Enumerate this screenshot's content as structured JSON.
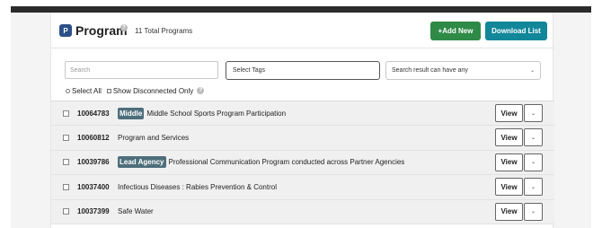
{
  "header": {
    "logo_letter": "P",
    "title": "Program",
    "total_label": "11 Total Programs",
    "add_button": "+Add New",
    "download_button": "Download List"
  },
  "filters": {
    "search_placeholder": "Search",
    "tags_label": "Select Tags",
    "match_select": "Search result can have any",
    "select_all_label": "Select All",
    "show_disconnected_label": "Show Disconnected Only"
  },
  "rows": [
    {
      "id": "10064783",
      "badge": "Middle",
      "title": "Middle School Sports Program Participation",
      "view_label": "View"
    },
    {
      "id": "10060812",
      "badge": "",
      "title": "Program and Services",
      "view_label": "View"
    },
    {
      "id": "10039786",
      "badge": "Lead Agency",
      "title": "Professional Communication Program conducted across Partner Agencies",
      "view_label": "View"
    },
    {
      "id": "10037400",
      "badge": "",
      "title": "Infectious Diseases : Rabies Prevention & Control",
      "view_label": "View"
    },
    {
      "id": "10037399",
      "badge": "",
      "title": "Safe Water",
      "view_label": "View"
    }
  ],
  "colors": {
    "add_button": "#2f8a48",
    "download_button": "#12879a",
    "badge": "#4e6e7b",
    "logo": "#2c4f88"
  },
  "icons": {
    "help": "question-circle-icon",
    "dropdown": "chevron-down-icon"
  }
}
